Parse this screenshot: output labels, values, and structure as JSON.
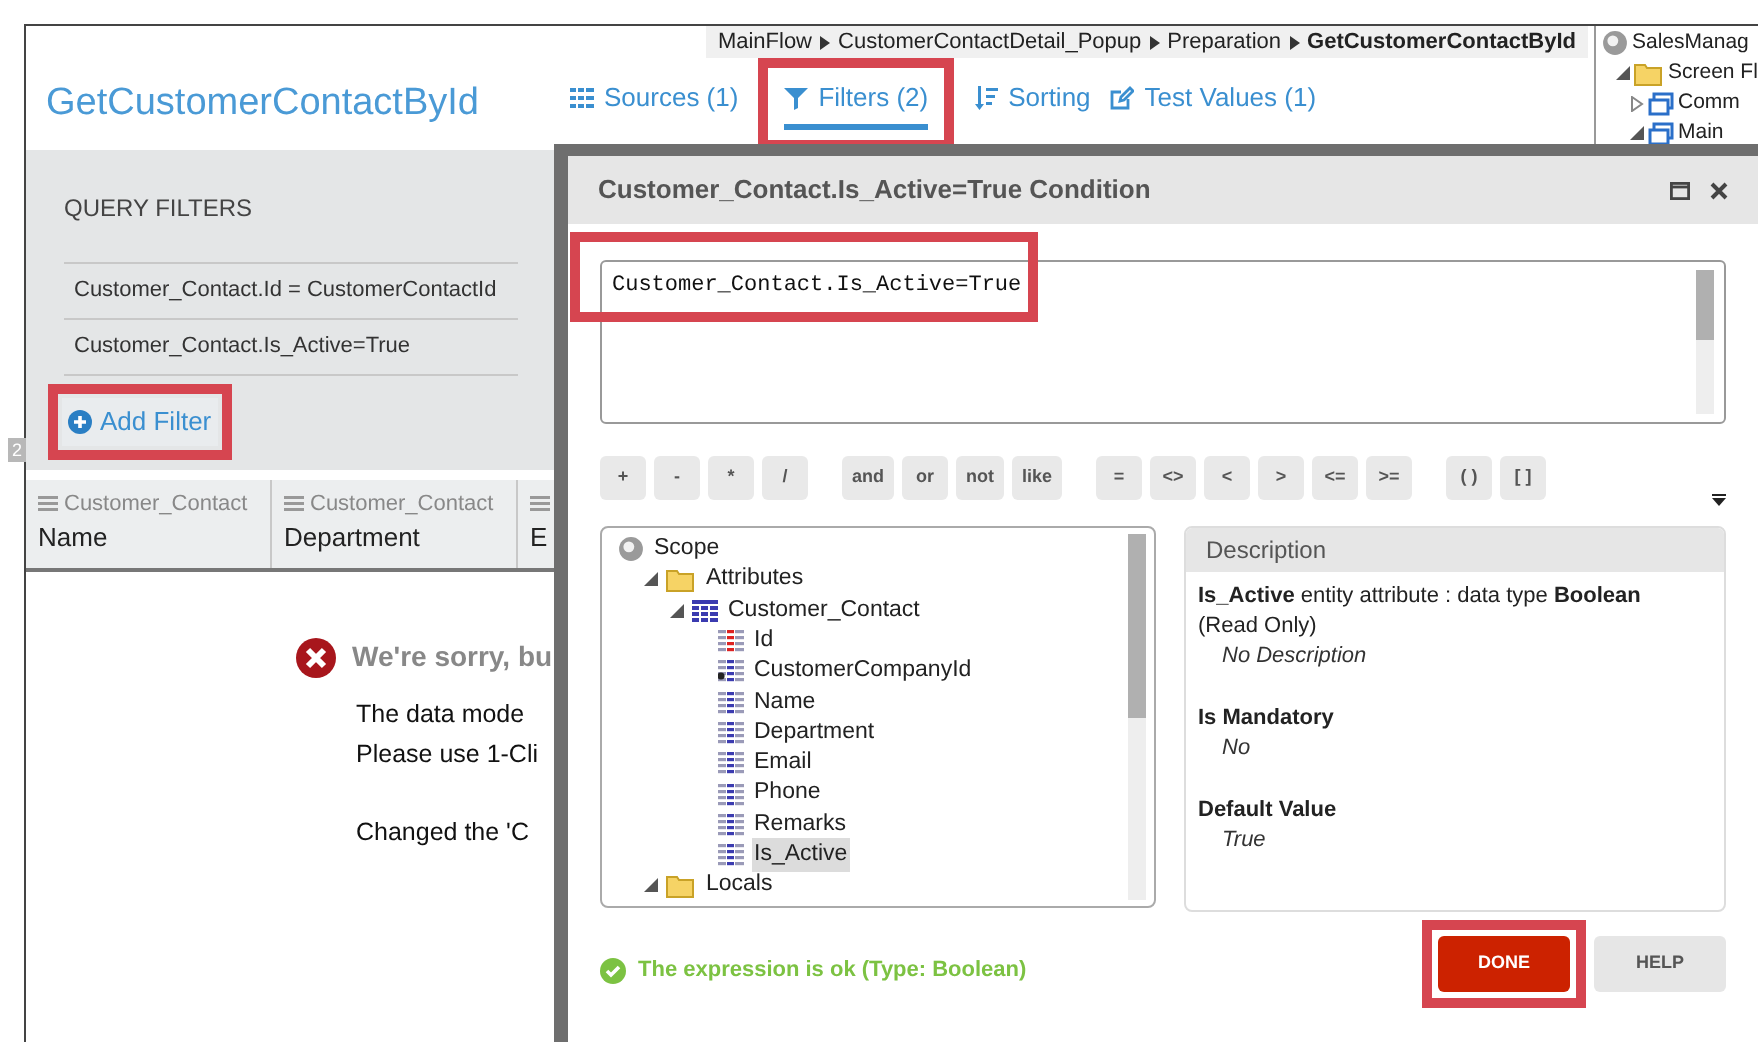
{
  "breadcrumb": [
    {
      "label": "MainFlow",
      "current": false
    },
    {
      "label": "CustomerContactDetail_Popup",
      "current": false
    },
    {
      "label": "Preparation",
      "current": false
    },
    {
      "label": "GetCustomerContactById",
      "current": true
    }
  ],
  "title": "GetCustomerContactById",
  "tabs": [
    {
      "label": "Sources (1)",
      "selected": false,
      "highlighted": false
    },
    {
      "label": "Filters (2)",
      "selected": true,
      "highlighted": true
    },
    {
      "label": "Sorting",
      "selected": false,
      "highlighted": false
    },
    {
      "label": "Test Values (1)",
      "selected": false,
      "highlighted": false
    }
  ],
  "side_tree": [
    {
      "label": "SalesManag",
      "kind": "module",
      "children": [
        {
          "label": "Screen Fl",
          "kind": "folder",
          "expanded": true,
          "children": [
            {
              "label": "Comm",
              "kind": "screen",
              "expanded": false
            },
            {
              "label": "Main",
              "kind": "screen",
              "expanded": true
            }
          ]
        }
      ]
    }
  ],
  "query_filters": {
    "heading": "QUERY FILTERS",
    "items": [
      "Customer_Contact.Id = CustomerContactId",
      "Customer_Contact.Is_Active=True"
    ],
    "add_button": {
      "label": "Add Filter",
      "highlighted": true
    }
  },
  "splitter_badge": "2",
  "table": {
    "columns": [
      {
        "source": "Customer_Contact",
        "name": "Name"
      },
      {
        "source": "Customer_Contact",
        "name": "Department"
      },
      {
        "name": "E"
      }
    ]
  },
  "error": {
    "heading": "We're sorry, bu",
    "paragraphs": [
      [
        "The data mode",
        "Please use 1-Cli"
      ],
      [
        "Changed the 'C"
      ]
    ]
  },
  "dialog": {
    "title": "Customer_Contact.Is_Active=True Condition",
    "expression": {
      "value": "Customer_Contact.Is_Active=True",
      "highlighted": true
    },
    "operator_groups": [
      [
        "+",
        "-",
        "*",
        "/"
      ],
      [
        "and",
        "or",
        "not",
        "like"
      ],
      [
        "=",
        "<>",
        "<",
        ">",
        "<=",
        ">="
      ],
      [
        "( )",
        "[ ]"
      ]
    ],
    "scope_tree": [
      {
        "label": "Scope",
        "kind": "scope",
        "children": [
          {
            "label": "Attributes",
            "kind": "folder",
            "expanded": true,
            "children": [
              {
                "label": "Customer_Contact",
                "kind": "entity",
                "expanded": true,
                "children": [
                  {
                    "label": "Id",
                    "kind": "key",
                    "selected": false
                  },
                  {
                    "label": "CustomerCompanyId",
                    "kind": "foreign_key",
                    "selected": false
                  },
                  {
                    "label": "Name",
                    "kind": "attribute",
                    "selected": false
                  },
                  {
                    "label": "Department",
                    "kind": "attribute",
                    "selected": false
                  },
                  {
                    "label": "Email",
                    "kind": "attribute",
                    "selected": false
                  },
                  {
                    "label": "Phone",
                    "kind": "attribute",
                    "selected": false
                  },
                  {
                    "label": "Remarks",
                    "kind": "attribute",
                    "selected": false
                  },
                  {
                    "label": "Is_Active",
                    "kind": "attribute",
                    "selected": true
                  }
                ]
              }
            ]
          },
          {
            "label": "Locals",
            "kind": "folder",
            "expanded": true
          }
        ]
      }
    ],
    "description": {
      "heading": "Description",
      "summary": "**Is_Active** entity attribute : data type **Boolean** (Read Only)",
      "note": "No Description",
      "properties": [
        {
          "label": "Is Mandatory",
          "value": "No"
        },
        {
          "label": "Default Value",
          "value": "True"
        }
      ]
    },
    "status": "The expression is ok (Type: Boolean)",
    "buttons": [
      {
        "label": "DONE",
        "kind": "primary",
        "highlighted": true
      },
      {
        "label": "HELP",
        "kind": "secondary",
        "highlighted": false
      }
    ]
  }
}
